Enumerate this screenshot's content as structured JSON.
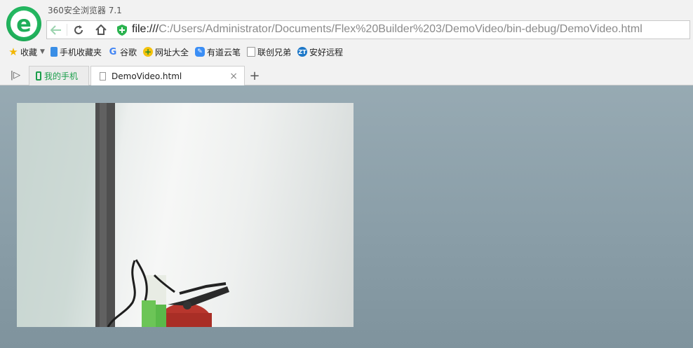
{
  "window": {
    "title": "360安全浏览器 7.1"
  },
  "address_bar": {
    "scheme": "file:///",
    "path": "C:/Users/Administrator/Documents/Flex%20Builder%203/DemoVideo/bin-debug/DemoVideo.html"
  },
  "bookmarks": [
    {
      "label": "收藏",
      "icon": "star-icon"
    },
    {
      "label": "手机收藏夹",
      "icon": "phone-icon"
    },
    {
      "label": "谷歌",
      "icon": "google-icon"
    },
    {
      "label": "网址大全",
      "icon": "web-directory-icon"
    },
    {
      "label": "有道云笔",
      "icon": "youdao-note-icon"
    },
    {
      "label": "联创兄弟",
      "icon": "page-icon"
    },
    {
      "label": "安好远程",
      "icon": "zt-remote-icon"
    }
  ],
  "tabs": [
    {
      "label": "我的手机",
      "icon": "phone-icon"
    },
    {
      "label": "DemoVideo.html",
      "icon": "page-icon",
      "active": true
    }
  ],
  "colors": {
    "brand_green": "#21b35d",
    "content_bg": "#8fa3ad"
  }
}
